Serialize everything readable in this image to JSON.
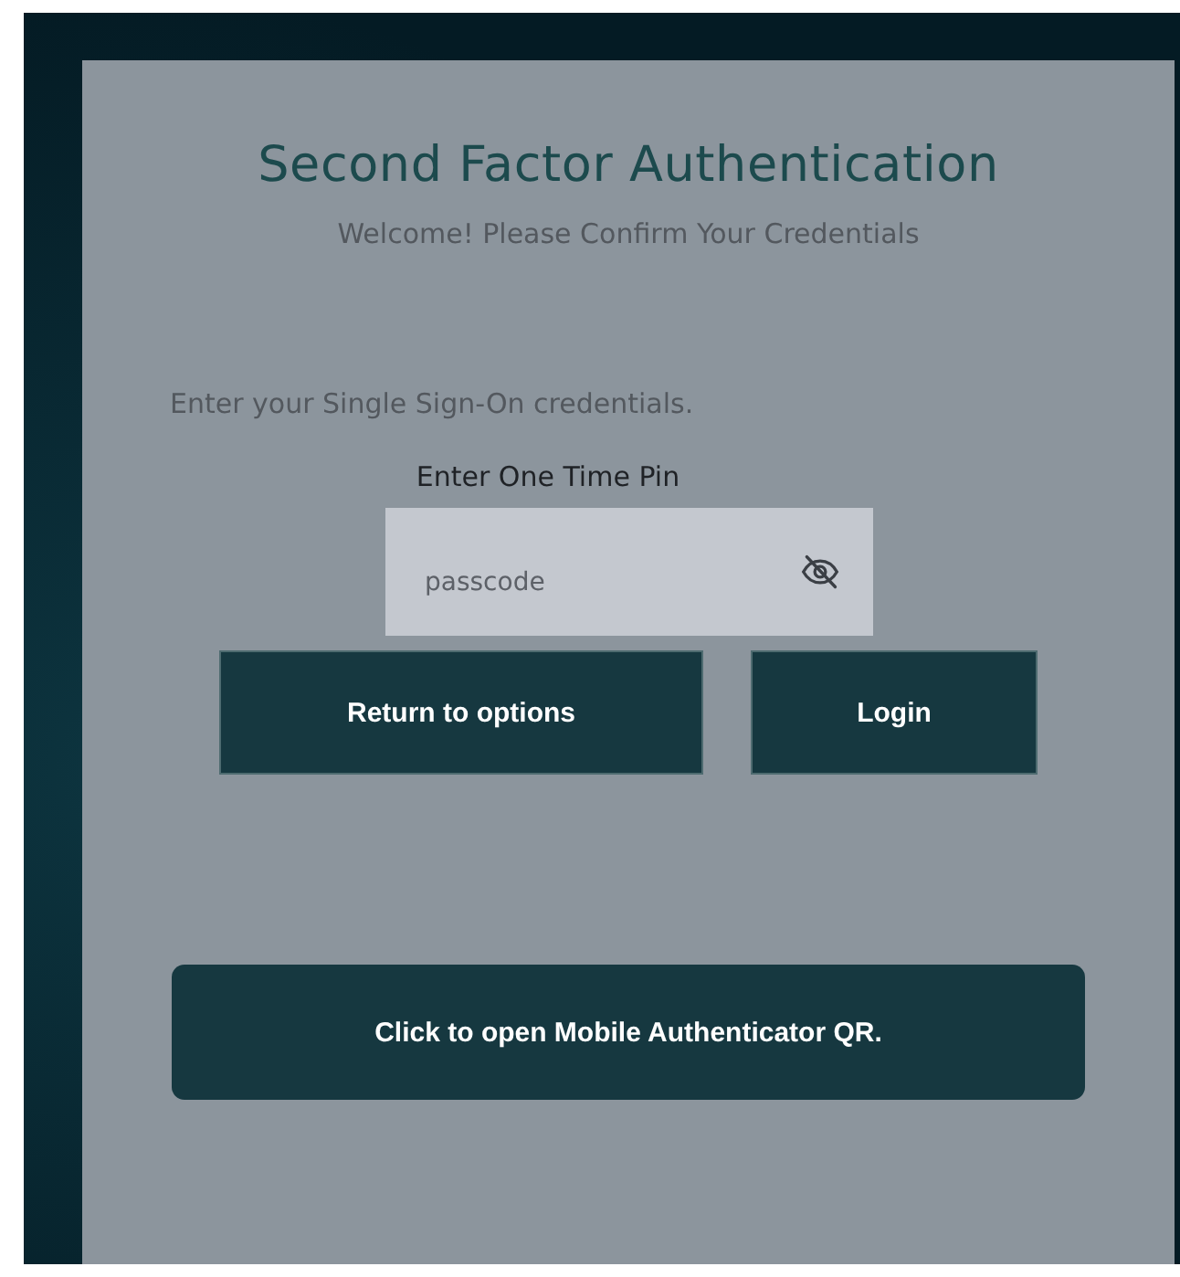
{
  "title": "Second Factor Authentication",
  "subtitle": "Welcome! Please Confirm Your Credentials",
  "instruction": "Enter your Single Sign-On credentials.",
  "pin_field": {
    "label": "Enter One Time Pin",
    "placeholder": "passcode"
  },
  "buttons": [
    {
      "label": "Return to options",
      "kind": "secondary"
    },
    {
      "label": "Login",
      "kind": "primary"
    }
  ],
  "qr_button": {
    "label": "Click to open Mobile Authenticator QR."
  }
}
